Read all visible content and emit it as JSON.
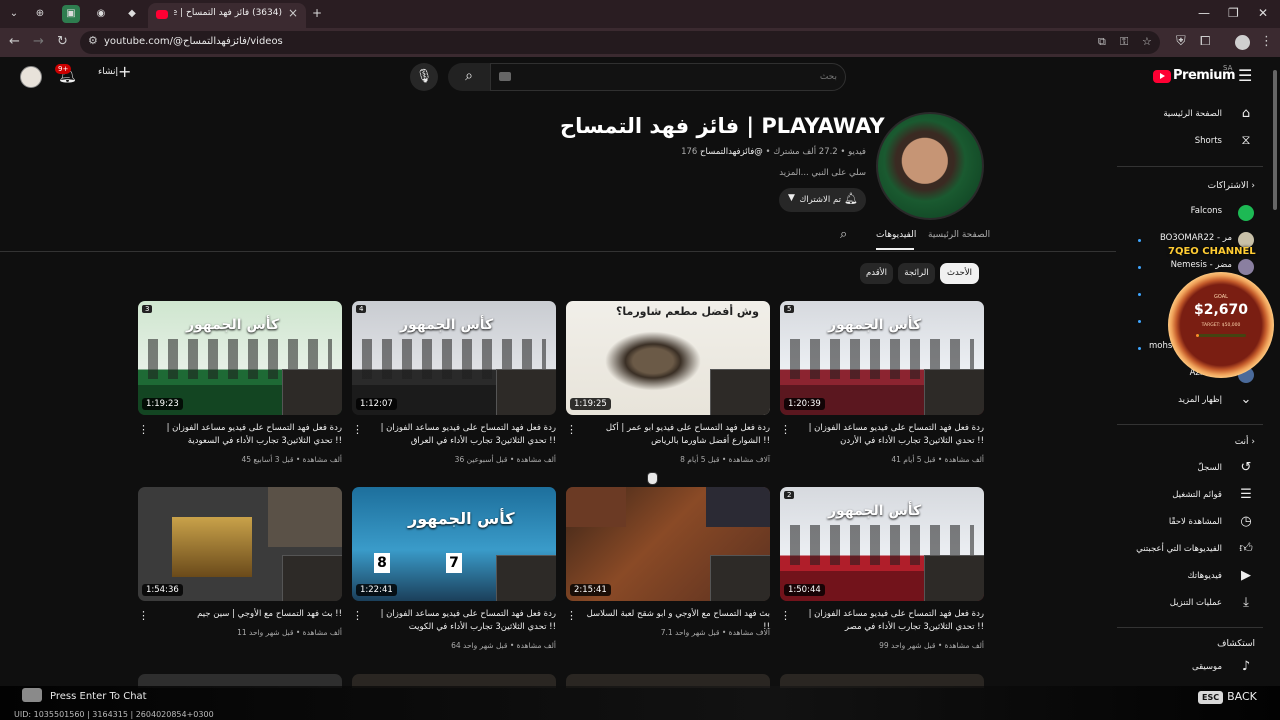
{
  "browser": {
    "tab_title": "(3634) فائز فهد التمساح | YouTube",
    "url": "youtube.com/@فائزفهدالتمساح/videos"
  },
  "masthead": {
    "create_label": "إنشاء",
    "notif_count": "9+",
    "search_placeholder": "بحث",
    "logo_text": "Premium",
    "region": "SA"
  },
  "channel": {
    "name": "فائز فهد التمساح | PLAYAWAY",
    "handle": "@فائزفهدالتمساح",
    "subscribers": "27.2 ألف مشترك",
    "videos": "176 فيديو",
    "description": "سلي على النبي ...المزيد",
    "subscribe_label": "تم الاشتراك"
  },
  "tabs": {
    "home": "الصفحة الرئيسية",
    "videos": "الفيديوهات"
  },
  "chips": [
    "الأحدث",
    "الرائجة",
    "الأقدم"
  ],
  "videos": [
    {
      "title": "ردة فعل فهد التمساح على فيديو مساعد الفوزان | تحدي الثلاثين3 تجارب الأداء في الأردن !!",
      "meta": "41 ألف مشاهدة • قبل 5 أيام",
      "duration": "1:20:39",
      "episode": "5",
      "banner": "كأس الجمهور",
      "tag": "الأردن"
    },
    {
      "title": "ردة فعل فهد التمساح على فيديو ابو عمر | أكل الشوارع أفضل شاورما بالرياض !!",
      "meta": "8 آلاف مشاهدة • قبل 5 أيام",
      "duration": "1:19:25",
      "episode": "",
      "banner": "وش أفضل مطعم شاورما؟",
      "tag": ""
    },
    {
      "title": "ردة فعل فهد التمساح على فيديو مساعد الفوزان | تحدي الثلاثين3 تجارب الأداء في العراق !!",
      "meta": "36 ألف مشاهدة • قبل أسبوعين",
      "duration": "1:12:07",
      "episode": "4",
      "banner": "كأس الجمهور",
      "tag": "العراق"
    },
    {
      "title": "ردة فعل فهد التمساح على فيديو مساعد الفوزان | تحدي الثلاثين3 تجارب الأداء في السعودية !!",
      "meta": "45 ألف مشاهدة • قبل 3 أسابيع",
      "duration": "1:19:23",
      "episode": "3",
      "banner": "كأس الجمهور",
      "tag": "السعودية"
    },
    {
      "title": "ردة فعل فهد التمساح على فيديو مساعد الفوزان | تحدي الثلاثين3 تجارب الأداء في مصر !!",
      "meta": "99 ألف مشاهدة • قبل شهر واحد",
      "duration": "1:50:44",
      "episode": "2",
      "banner": "كأس الجمهور",
      "tag": "مصر"
    },
    {
      "title": "بث فهد التمساح مع الأوجي و ابو شقح لعبة السلاسل !!",
      "meta": "7.1 آلاف مشاهدة • قبل شهر واحد",
      "duration": "2:15:41",
      "episode": "",
      "banner": "",
      "tag": ""
    },
    {
      "title": "ردة فعل فهد التمساح على فيديو مساعد الفوزان | تحدي الثلاثين3 تجارب الأداء في الكويت !!",
      "meta": "64 ألف مشاهدة • قبل شهر واحد",
      "duration": "1:22:41",
      "episode": "",
      "banner": "كأس الجمهور",
      "tag": "الكويت"
    },
    {
      "title": "بث فهد التمساح مع الأوجي | سين جيم !!",
      "meta": "11 ألف مشاهدة • قبل شهر واحد",
      "duration": "1:54:36",
      "episode": "",
      "banner": "",
      "tag": ""
    }
  ],
  "sidebar": {
    "home": "الصفحة الرئيسية",
    "shorts": "Shorts",
    "subscriptions_head": "الاشتراكات",
    "subs": [
      {
        "name": "Falcons",
        "color": "#1db954"
      },
      {
        "name": "BO3OMAR22 - مر",
        "color": "#c8c0a8"
      },
      {
        "name": "Nemesis - مضر",
        "color": "#8a7fa0"
      },
      {
        "name": "mohs",
        "color": "#6a6a6a"
      },
      {
        "name": "Aziz - عزيز",
        "color": "#4a6a9a"
      }
    ],
    "show_more": "إظهار المزيد",
    "you_head": "أنت",
    "you_items": [
      "السجلّ",
      "قوائم التشغيل",
      "المشاهدة لاحقًا",
      "الفيديوهات التي أعجبتني",
      "فيديوهاتك",
      "عمليات التنزيل"
    ],
    "explore_head": "استكشاف",
    "music": "موسيقى"
  },
  "overlay": {
    "channel_tag": "7QEO CHANNEL",
    "goal_label": "GOAL",
    "goal_amount": "$2,670",
    "goal_target": "TARGET: $50,000",
    "goal_progress": 0.053,
    "chat_hint": "Press Enter To Chat",
    "uid": "UID: 1035501560 | 3164315 | 2604020854+0300",
    "esc": "ESC",
    "back": "BACK"
  },
  "colors": {
    "accent": "#ff0033",
    "background": "#0f0f0f",
    "link": "#3ea6ff"
  }
}
